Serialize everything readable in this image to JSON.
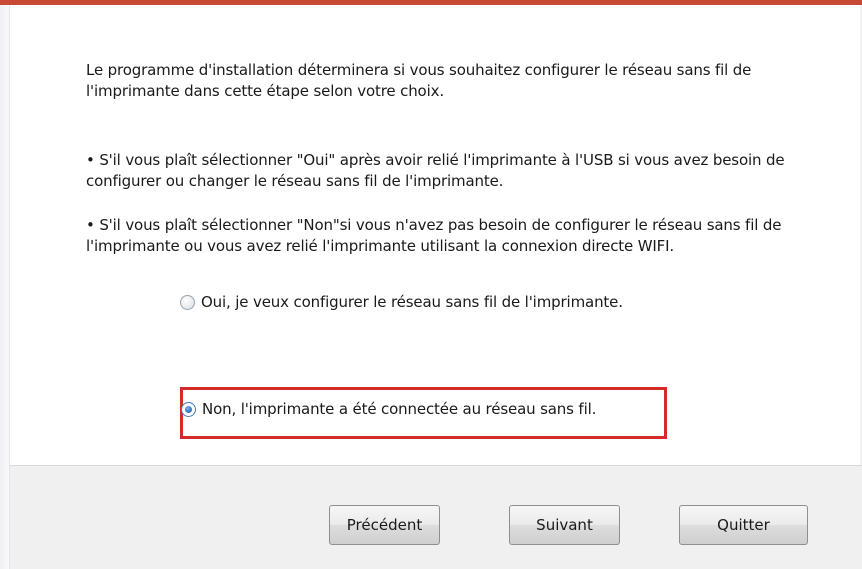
{
  "intro_text": "Le programme d'installation déterminera si vous souhaitez configurer le réseau sans fil de l'imprimante dans cette étape selon votre choix.",
  "bullet_oui": "• S'il vous plaît sélectionner \"Oui\" après avoir relié l'imprimante à l'USB si vous avez besoin de configurer ou changer le réseau sans fil de l'imprimante.",
  "bullet_non": "•  S'il vous plaît sélectionner  \"Non\"si vous n'avez pas besoin de configurer le réseau sans fil de l'imprimante ou vous avez relié l'imprimante utilisant la connexion directe WIFI.",
  "options": {
    "oui": {
      "label": "Oui, je veux configurer le réseau sans fil de l'imprimante.",
      "selected": false
    },
    "non": {
      "label": "Non, l'imprimante a été connectée au réseau sans fil.",
      "selected": true
    }
  },
  "buttons": {
    "previous": "Précédent",
    "next": "Suivant",
    "quit": "Quitter"
  },
  "colors": {
    "title_bar_accent": "#c84a35",
    "highlight_border": "#d42a2a",
    "footer_background": "#f0f0f0"
  }
}
